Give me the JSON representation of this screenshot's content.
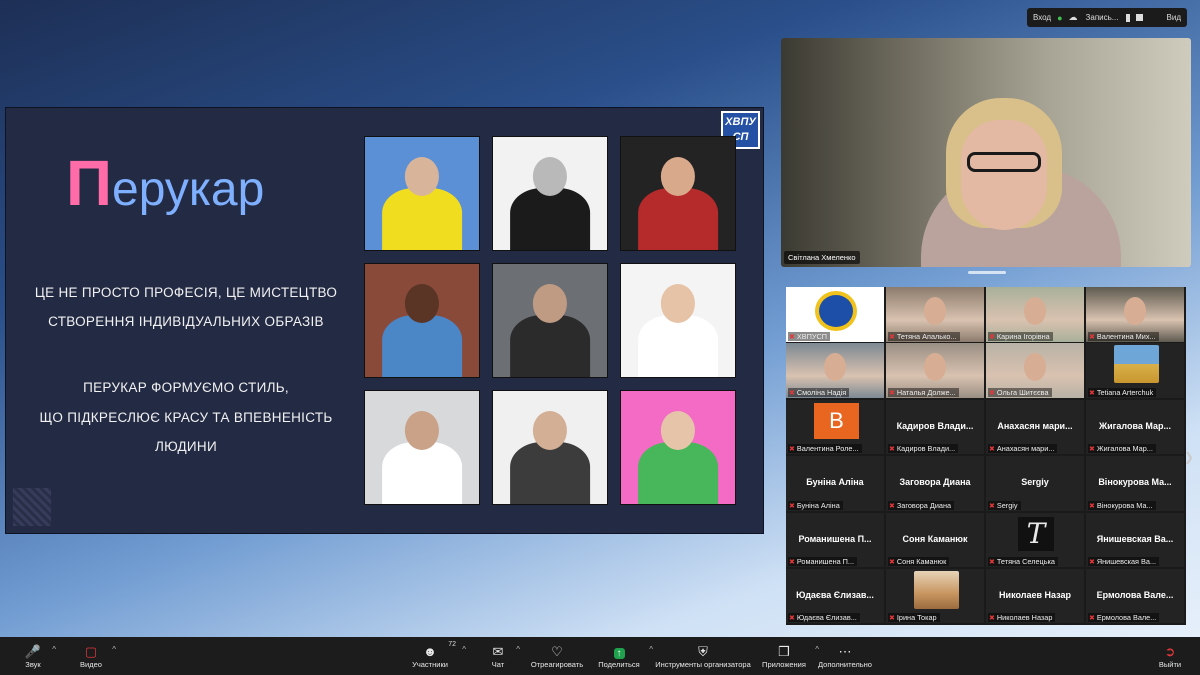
{
  "topbar": {
    "enter": "Вход",
    "record": "Запись...",
    "view": "Вид"
  },
  "slide": {
    "logo_line1": "ХВПУ",
    "logo_line2": "СП",
    "title_first": "П",
    "title_rest": "ерукар",
    "line1": "ЦЕ НЕ ПРОСТО ПРОФЕСІЯ, ЦЕ МИСТЕЦТВО",
    "line2": "СТВОРЕННЯ ІНДИВІДУАЛЬНИХ ОБРАЗІВ",
    "line3": "ПЕРУКАР ФОРМУЄМО СТИЛЬ,",
    "line4": "ЩО ПІДКРЕСЛЮЄ КРАСУ ТА ВПЕВНЕНІСТЬ",
    "line5": "ЛЮДИНИ",
    "photos": [
      {
        "bg": "#5b8fd6",
        "fig": "#f1dd1f",
        "head": "#d8b59a"
      },
      {
        "bg": "#f2f2f2",
        "fig": "#1b1b1b",
        "head": "#b9b9b9"
      },
      {
        "bg": "#232323",
        "fig": "#b52a2a",
        "head": "#d9a98b"
      },
      {
        "bg": "#8a4a3a",
        "fig": "#4b86c7",
        "head": "#5a3526"
      },
      {
        "bg": "#6c6f74",
        "fig": "#2b2b2b",
        "head": "#c09b84"
      },
      {
        "bg": "#f4f4f4",
        "fig": "#ffffff",
        "head": "#e6c2a6"
      },
      {
        "bg": "#d7d9db",
        "fig": "#ffffff",
        "head": "#c9a287"
      },
      {
        "bg": "#f0f0f0",
        "fig": "#3c3c3c",
        "head": "#d3b095"
      },
      {
        "bg": "#f36bc4",
        "fig": "#48b65a",
        "head": "#e6c4a9"
      }
    ]
  },
  "speaker": {
    "name": "Світлана Хмеленко"
  },
  "gallery": {
    "tiles": [
      {
        "title": "",
        "label": "ХВПУСП",
        "kind": "logo",
        "bg": "#ffffff"
      },
      {
        "title": "",
        "label": "Тетяна Апалько...",
        "kind": "video",
        "bg": "#8c7c6d"
      },
      {
        "title": "",
        "label": "Карина Ігорівна",
        "kind": "video",
        "bg": "#a8b09a"
      },
      {
        "title": "",
        "label": "Валентина Mих...",
        "kind": "video",
        "bg": "#5e5b50"
      },
      {
        "title": "",
        "label": "Смоліна Надія",
        "kind": "video",
        "bg": "#7d8993"
      },
      {
        "title": "",
        "label": "Наталья Долже...",
        "kind": "video",
        "bg": "#9a8f84"
      },
      {
        "title": "",
        "label": "Ольга Шитєєва",
        "kind": "video",
        "bg": "#b8b2a6"
      },
      {
        "title": "",
        "label": "Tetiana Arterchuk",
        "kind": "photo",
        "bg": "#232323"
      },
      {
        "title": "",
        "label": "Валентина Роле...",
        "kind": "letter",
        "letter": "В",
        "bg": "#232323"
      },
      {
        "title": "Кадиров Влади...",
        "label": "Кадиров Влади...",
        "kind": "name",
        "bg": "#232323"
      },
      {
        "title": "Анахасян мари...",
        "label": "Анахасян мари...",
        "kind": "name",
        "bg": "#232323"
      },
      {
        "title": "Жигалова Мар...",
        "label": "Жигалова Мар...",
        "kind": "name",
        "bg": "#232323"
      },
      {
        "title": "Буніна Аліна",
        "label": "Буніна Аліна",
        "kind": "name",
        "bg": "#232323"
      },
      {
        "title": "Заговора Диана",
        "label": "Заговора Диана",
        "kind": "name",
        "bg": "#232323"
      },
      {
        "title": "Sergiy",
        "label": "Sergiy",
        "kind": "name",
        "bg": "#232323"
      },
      {
        "title": "Вінокурова Ма...",
        "label": "Вінокурова Ма...",
        "kind": "name",
        "bg": "#232323"
      },
      {
        "title": "Романишена П...",
        "label": "Романишена П...",
        "kind": "name",
        "bg": "#232323"
      },
      {
        "title": "Соня Каманюк",
        "label": "Соня Каманюк",
        "kind": "name",
        "bg": "#232323"
      },
      {
        "title": "",
        "label": "Тетяна Селецька",
        "kind": "monogram",
        "bg": "#232323"
      },
      {
        "title": "Янишевская Ва...",
        "label": "Янишевская Ва...",
        "kind": "name",
        "bg": "#232323"
      },
      {
        "title": "Юдаєва Єлизав...",
        "label": "Юдаєва Єлизав...",
        "kind": "name",
        "bg": "#232323"
      },
      {
        "title": "",
        "label": "Ірина Токар",
        "kind": "photo2",
        "bg": "#232323"
      },
      {
        "title": "Николаев Назар",
        "label": "Николаев Назар",
        "kind": "name",
        "bg": "#232323"
      },
      {
        "title": "Ермолова Вале...",
        "label": "Ермолова Вале...",
        "kind": "name",
        "bg": "#232323"
      }
    ]
  },
  "toolbar": {
    "audio": "Звук",
    "video": "Видео",
    "participants": "Участники",
    "participants_count": "72",
    "chat": "Чат",
    "react": "Отреагировать",
    "share": "Поделиться",
    "host_tools": "Инструменты организатора",
    "apps": "Приложения",
    "more": "Дополнительно",
    "leave": "Выйти"
  }
}
